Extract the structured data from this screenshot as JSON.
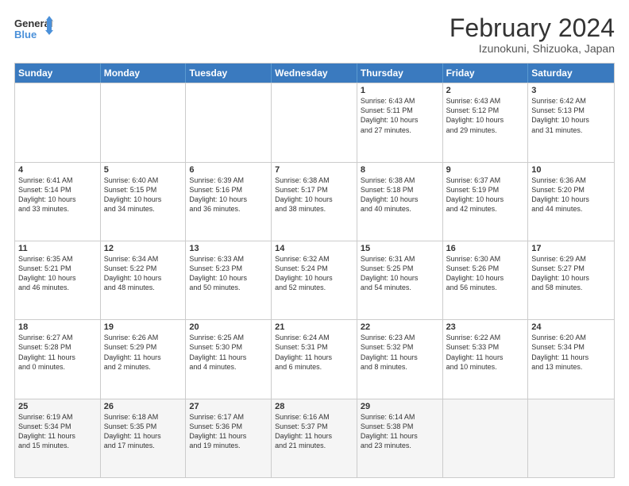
{
  "header": {
    "logo_line1": "General",
    "logo_line2": "Blue",
    "title": "February 2024",
    "location": "Izunokuni, Shizuoka, Japan"
  },
  "days": [
    "Sunday",
    "Monday",
    "Tuesday",
    "Wednesday",
    "Thursday",
    "Friday",
    "Saturday"
  ],
  "weeks": [
    [
      {
        "date": "",
        "info": ""
      },
      {
        "date": "",
        "info": ""
      },
      {
        "date": "",
        "info": ""
      },
      {
        "date": "",
        "info": ""
      },
      {
        "date": "1",
        "info": "Sunrise: 6:43 AM\nSunset: 5:11 PM\nDaylight: 10 hours\nand 27 minutes."
      },
      {
        "date": "2",
        "info": "Sunrise: 6:43 AM\nSunset: 5:12 PM\nDaylight: 10 hours\nand 29 minutes."
      },
      {
        "date": "3",
        "info": "Sunrise: 6:42 AM\nSunset: 5:13 PM\nDaylight: 10 hours\nand 31 minutes."
      }
    ],
    [
      {
        "date": "4",
        "info": "Sunrise: 6:41 AM\nSunset: 5:14 PM\nDaylight: 10 hours\nand 33 minutes."
      },
      {
        "date": "5",
        "info": "Sunrise: 6:40 AM\nSunset: 5:15 PM\nDaylight: 10 hours\nand 34 minutes."
      },
      {
        "date": "6",
        "info": "Sunrise: 6:39 AM\nSunset: 5:16 PM\nDaylight: 10 hours\nand 36 minutes."
      },
      {
        "date": "7",
        "info": "Sunrise: 6:38 AM\nSunset: 5:17 PM\nDaylight: 10 hours\nand 38 minutes."
      },
      {
        "date": "8",
        "info": "Sunrise: 6:38 AM\nSunset: 5:18 PM\nDaylight: 10 hours\nand 40 minutes."
      },
      {
        "date": "9",
        "info": "Sunrise: 6:37 AM\nSunset: 5:19 PM\nDaylight: 10 hours\nand 42 minutes."
      },
      {
        "date": "10",
        "info": "Sunrise: 6:36 AM\nSunset: 5:20 PM\nDaylight: 10 hours\nand 44 minutes."
      }
    ],
    [
      {
        "date": "11",
        "info": "Sunrise: 6:35 AM\nSunset: 5:21 PM\nDaylight: 10 hours\nand 46 minutes."
      },
      {
        "date": "12",
        "info": "Sunrise: 6:34 AM\nSunset: 5:22 PM\nDaylight: 10 hours\nand 48 minutes."
      },
      {
        "date": "13",
        "info": "Sunrise: 6:33 AM\nSunset: 5:23 PM\nDaylight: 10 hours\nand 50 minutes."
      },
      {
        "date": "14",
        "info": "Sunrise: 6:32 AM\nSunset: 5:24 PM\nDaylight: 10 hours\nand 52 minutes."
      },
      {
        "date": "15",
        "info": "Sunrise: 6:31 AM\nSunset: 5:25 PM\nDaylight: 10 hours\nand 54 minutes."
      },
      {
        "date": "16",
        "info": "Sunrise: 6:30 AM\nSunset: 5:26 PM\nDaylight: 10 hours\nand 56 minutes."
      },
      {
        "date": "17",
        "info": "Sunrise: 6:29 AM\nSunset: 5:27 PM\nDaylight: 10 hours\nand 58 minutes."
      }
    ],
    [
      {
        "date": "18",
        "info": "Sunrise: 6:27 AM\nSunset: 5:28 PM\nDaylight: 11 hours\nand 0 minutes."
      },
      {
        "date": "19",
        "info": "Sunrise: 6:26 AM\nSunset: 5:29 PM\nDaylight: 11 hours\nand 2 minutes."
      },
      {
        "date": "20",
        "info": "Sunrise: 6:25 AM\nSunset: 5:30 PM\nDaylight: 11 hours\nand 4 minutes."
      },
      {
        "date": "21",
        "info": "Sunrise: 6:24 AM\nSunset: 5:31 PM\nDaylight: 11 hours\nand 6 minutes."
      },
      {
        "date": "22",
        "info": "Sunrise: 6:23 AM\nSunset: 5:32 PM\nDaylight: 11 hours\nand 8 minutes."
      },
      {
        "date": "23",
        "info": "Sunrise: 6:22 AM\nSunset: 5:33 PM\nDaylight: 11 hours\nand 10 minutes."
      },
      {
        "date": "24",
        "info": "Sunrise: 6:20 AM\nSunset: 5:34 PM\nDaylight: 11 hours\nand 13 minutes."
      }
    ],
    [
      {
        "date": "25",
        "info": "Sunrise: 6:19 AM\nSunset: 5:34 PM\nDaylight: 11 hours\nand 15 minutes."
      },
      {
        "date": "26",
        "info": "Sunrise: 6:18 AM\nSunset: 5:35 PM\nDaylight: 11 hours\nand 17 minutes."
      },
      {
        "date": "27",
        "info": "Sunrise: 6:17 AM\nSunset: 5:36 PM\nDaylight: 11 hours\nand 19 minutes."
      },
      {
        "date": "28",
        "info": "Sunrise: 6:16 AM\nSunset: 5:37 PM\nDaylight: 11 hours\nand 21 minutes."
      },
      {
        "date": "29",
        "info": "Sunrise: 6:14 AM\nSunset: 5:38 PM\nDaylight: 11 hours\nand 23 minutes."
      },
      {
        "date": "",
        "info": ""
      },
      {
        "date": "",
        "info": ""
      }
    ]
  ]
}
